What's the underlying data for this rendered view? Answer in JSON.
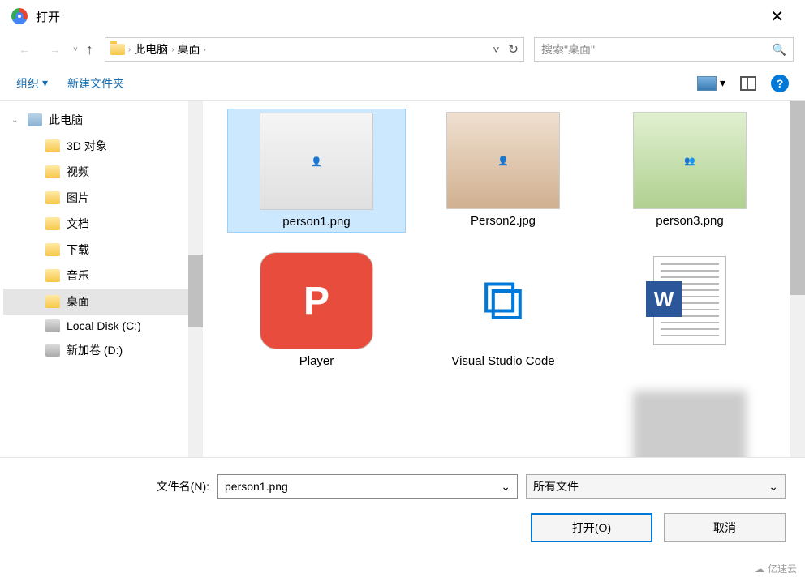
{
  "title": "打开",
  "close_glyph": "✕",
  "nav": {
    "back_glyph": "←",
    "fwd_glyph": "→",
    "up_glyph": "↑",
    "refresh_glyph": "↻",
    "dropdown_glyph": "˅"
  },
  "breadcrumb": {
    "root": "此电脑",
    "current": "桌面",
    "sep": "›"
  },
  "search": {
    "placeholder": "搜索\"桌面\"",
    "mag_glyph": "🔍"
  },
  "toolbar": {
    "organize": "组织",
    "new_folder": "新建文件夹",
    "caret": "▾",
    "help_glyph": "?"
  },
  "tree": {
    "items": [
      {
        "label": "此电脑",
        "icon": "computer",
        "level": 1,
        "expanded": true
      },
      {
        "label": "3D 对象",
        "icon": "folder",
        "level": 2
      },
      {
        "label": "视频",
        "icon": "folder",
        "level": 2
      },
      {
        "label": "图片",
        "icon": "folder",
        "level": 2
      },
      {
        "label": "文档",
        "icon": "folder",
        "level": 2
      },
      {
        "label": "下载",
        "icon": "folder",
        "level": 2
      },
      {
        "label": "音乐",
        "icon": "folder",
        "level": 2
      },
      {
        "label": "桌面",
        "icon": "folder",
        "level": 2,
        "selected": true
      },
      {
        "label": "Local Disk (C:)",
        "icon": "disk",
        "level": 2
      },
      {
        "label": "新加卷 (D:)",
        "icon": "disk",
        "level": 2
      }
    ]
  },
  "files": [
    {
      "name": "person1.png",
      "type": "image",
      "selected": true
    },
    {
      "name": "Person2.jpg",
      "type": "image"
    },
    {
      "name": "person3.png",
      "type": "image"
    },
    {
      "name": "Player",
      "type": "shortcut",
      "app": "P"
    },
    {
      "name": "Visual Studio Code",
      "type": "shortcut",
      "app": "vscode"
    },
    {
      "name": "",
      "type": "word"
    },
    {
      "name": "",
      "type": "blur"
    }
  ],
  "footer": {
    "filename_label": "文件名(N):",
    "filename_value": "person1.png",
    "filetype_value": "所有文件",
    "open_label": "打开(O)",
    "cancel_label": "取消",
    "caret": "⌄"
  },
  "watermark": "亿速云"
}
